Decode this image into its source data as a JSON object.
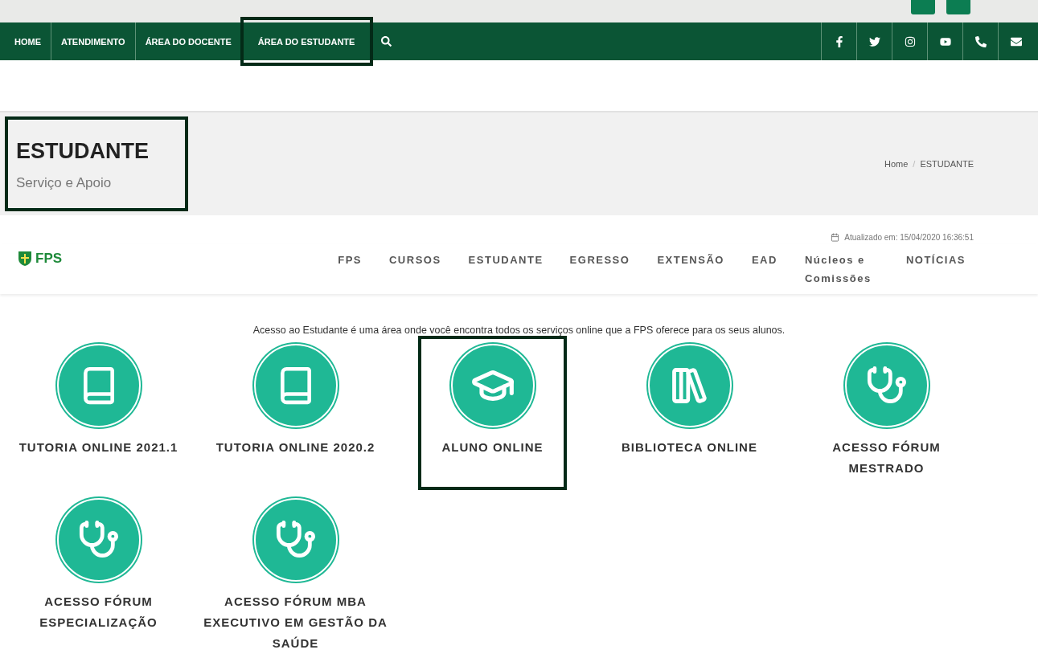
{
  "top_nav": {
    "items": [
      {
        "label": "HOME",
        "highlighted": false
      },
      {
        "label": "ATENDIMENTO",
        "highlighted": false
      },
      {
        "label": "ÁREA DO DOCENTE",
        "highlighted": false
      },
      {
        "label": "ÁREA DO ESTUDANTE",
        "highlighted": true
      }
    ]
  },
  "page_header": {
    "title": "ESTUDANTE",
    "subtitle": "Serviço e Apoio",
    "highlighted": true,
    "breadcrumb": [
      "Home",
      "ESTUDANTE"
    ],
    "breadcrumb_separator": "/"
  },
  "updated": "Atualizado em: 15/04/2020 16:36:51",
  "main_nav": {
    "logo": "FPS",
    "items": [
      "FPS",
      "CURSOS",
      "ESTUDANTE",
      "EGRESSO",
      "EXTENSÃO",
      "EAD",
      "Núcleos e Comissões",
      "NOTÍCIAS"
    ]
  },
  "intro": "Acesso ao Estudante é uma área onde você encontra todos os serviços online que a FPS oferece para os seus alunos.",
  "cards": [
    {
      "kind": "book",
      "label": "TUTORIA ONLINE 2021.1",
      "highlighted": false
    },
    {
      "kind": "book",
      "label": "TUTORIA ONLINE 2020.2",
      "highlighted": false
    },
    {
      "kind": "cap",
      "label": "ALUNO ONLINE",
      "highlighted": true
    },
    {
      "kind": "books",
      "label": "BIBLIOTECA ONLINE",
      "highlighted": false
    },
    {
      "kind": "stethoscope",
      "label": "ACESSO FÓRUM MESTRADO",
      "highlighted": false
    },
    {
      "kind": "stethoscope",
      "label": "ACESSO FÓRUM ESPECIALIZAÇÃO",
      "highlighted": false
    },
    {
      "kind": "stethoscope",
      "label": "ACESSO FÓRUM MBA EXECUTIVO EM GESTÃO DA SAÚDE",
      "highlighted": false
    }
  ]
}
